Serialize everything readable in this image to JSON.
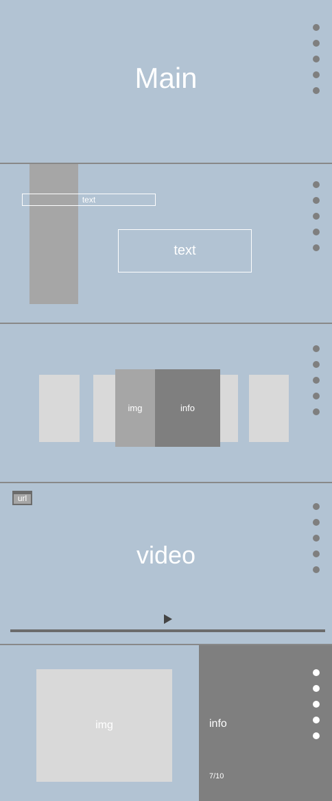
{
  "sections": {
    "main": {
      "title": "Main"
    },
    "text_section": {
      "label_small": "text",
      "label_large": "text"
    },
    "carousel": {
      "img_label": "img",
      "info_label": "info"
    },
    "video": {
      "url_label": "url",
      "title": "video"
    },
    "detail": {
      "img_label": "img",
      "info_label": "info",
      "page_indicator": "7/10"
    }
  },
  "icons": {
    "pagination": "dot-indicator",
    "play": "play-icon"
  },
  "colors": {
    "background": "#b2c3d3",
    "divider": "#888888",
    "dot": "#7f7f7f",
    "dot_active": "#ffffff",
    "gray": "#a6a6a6",
    "light_gray": "#d9d9d9",
    "dark_gray": "#7f7f7f"
  }
}
